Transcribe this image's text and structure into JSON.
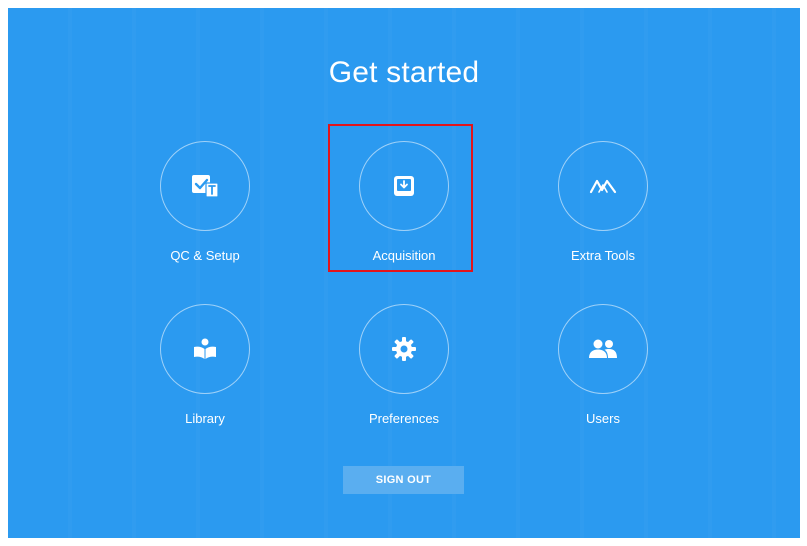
{
  "app": {
    "heading": "Get started"
  },
  "tiles": [
    {
      "label": "QC & Setup",
      "icon": "qc-setup-icon"
    },
    {
      "label": "Acquisition",
      "icon": "acquisition-icon"
    },
    {
      "label": "Extra Tools",
      "icon": "extra-tools-icon"
    },
    {
      "label": "Library",
      "icon": "library-icon"
    },
    {
      "label": "Preferences",
      "icon": "gear-icon"
    },
    {
      "label": "Users",
      "icon": "users-icon"
    }
  ],
  "footer": {
    "sign_out_label": "SIGN OUT"
  },
  "colors": {
    "background": "#2b9af0",
    "highlight": "#e3141b",
    "button": "#5aaef0"
  }
}
